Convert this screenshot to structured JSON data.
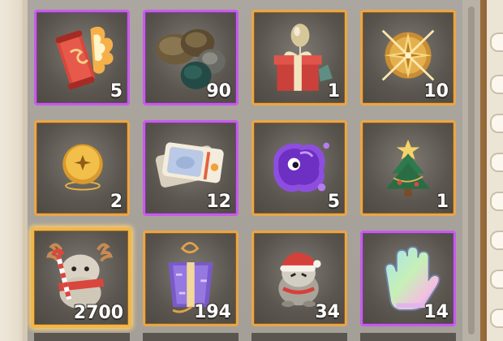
{
  "inventory": {
    "rows": [
      [
        {
          "name": "fire-scroll",
          "count": "5",
          "rarity": "purple",
          "icon": "scroll-icon"
        },
        {
          "name": "ore-pile",
          "count": "90",
          "rarity": "purple",
          "icon": "ore-icon"
        },
        {
          "name": "balloon-gift",
          "count": "1",
          "rarity": "orange",
          "icon": "gift-box-icon"
        },
        {
          "name": "golden-compass",
          "count": "10",
          "rarity": "orange",
          "icon": "compass-icon"
        }
      ],
      [
        {
          "name": "gold-coin",
          "count": "2",
          "rarity": "orange",
          "icon": "coin-icon"
        },
        {
          "name": "tickets",
          "count": "12",
          "rarity": "purple",
          "icon": "ticket-icon"
        },
        {
          "name": "purple-slime",
          "count": "5",
          "rarity": "orange",
          "icon": "slime-icon"
        },
        {
          "name": "christmas-tree",
          "count": "1",
          "rarity": "orange",
          "icon": "tree-icon"
        }
      ],
      [
        {
          "name": "reindeer-candy",
          "count": "2700",
          "rarity": "gold",
          "icon": "reindeer-icon"
        },
        {
          "name": "purple-gift-charm",
          "count": "194",
          "rarity": "orange",
          "icon": "charm-gift-icon"
        },
        {
          "name": "santa-creature",
          "count": "34",
          "rarity": "orange",
          "icon": "santa-creature-icon"
        },
        {
          "name": "rainbow-glove",
          "count": "14",
          "rarity": "purple",
          "icon": "glove-icon"
        }
      ]
    ]
  },
  "colors": {
    "purple_border": "#c65ce8",
    "orange_border": "#e8a64a",
    "gold_border": "#f0b74a"
  }
}
